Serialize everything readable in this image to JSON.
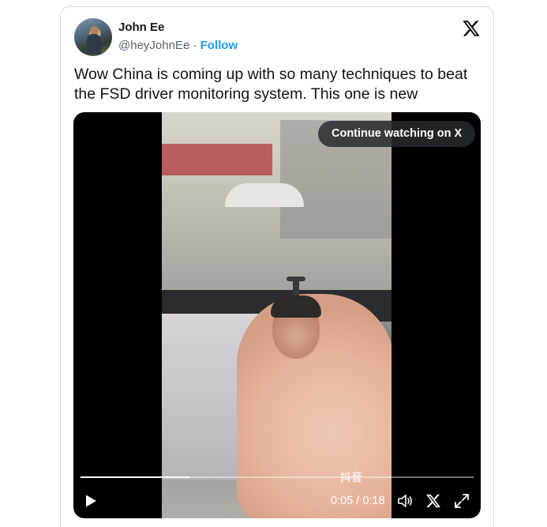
{
  "author": {
    "name": "John Ee",
    "handle": "@heyJohnEe",
    "separator": "·",
    "follow_label": "Follow"
  },
  "tweet": {
    "text": "Wow China is coming up with so many techniques to beat the FSD driver monitoring system. This one is new"
  },
  "video": {
    "continue_label": "Continue watching on X",
    "current_time": "0:05",
    "duration": "0:18",
    "time_separator": " / ",
    "progress": 0.28,
    "watermark": "抖音"
  },
  "icons": {
    "brand": "x-logo-icon",
    "play": "play-icon",
    "volume": "volume-icon",
    "x_button": "x-logo-icon",
    "fullscreen": "fullscreen-icon"
  },
  "colors": {
    "follow": "#1d9bf0",
    "handle": "#536471",
    "text": "#0f1419",
    "border": "#cfd9de"
  }
}
